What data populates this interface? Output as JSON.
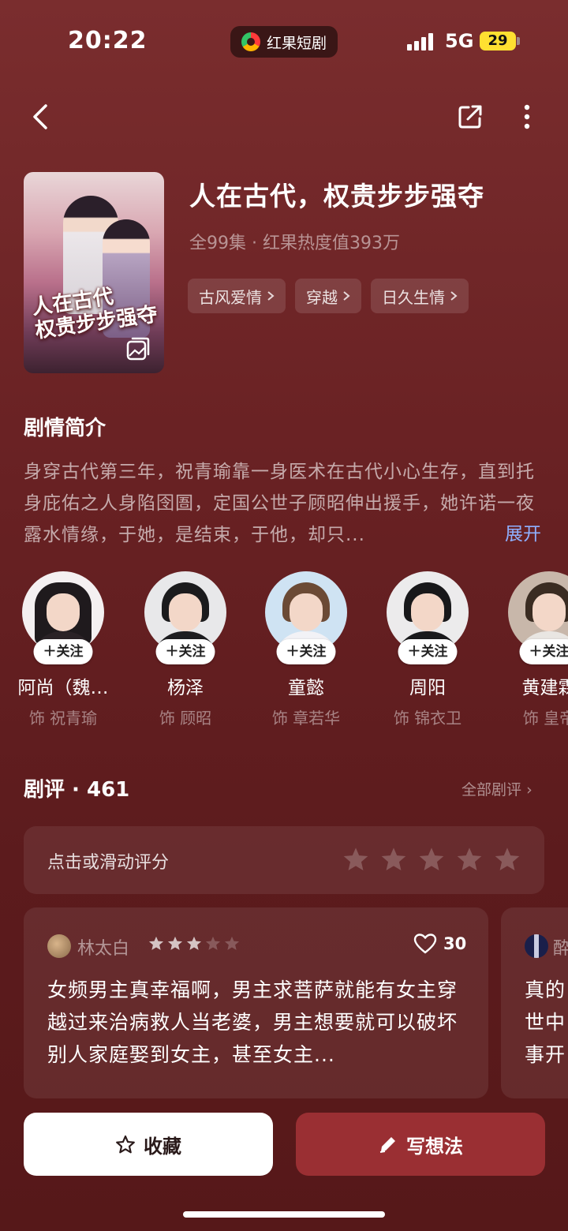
{
  "status_bar": {
    "time": "20:22",
    "app_name": "红果短剧",
    "network": "5G",
    "battery": "29"
  },
  "drama": {
    "title": "人在古代，权贵步步强夺",
    "meta": "全99集 · 红果热度值393万",
    "cover_title_line1": "人在古代",
    "cover_title_line2": "权贵步步强夺",
    "tags": [
      {
        "label": "古风爱情"
      },
      {
        "label": "穿越"
      },
      {
        "label": "日久生情"
      }
    ]
  },
  "synopsis": {
    "heading": "剧情简介",
    "text": "身穿古代第三年，祝青瑜靠一身医术在古代小心生存，直到托身庇佑之人身陷囹圄，定国公世子顾昭伸出援手，她许诺一夜露水情缘，于她，是结束，于他，却只...",
    "expand_label": "展开"
  },
  "cast": {
    "follow_label": "关注",
    "members": [
      {
        "name": "阿尚（魏…",
        "role": "饰 祝青瑜"
      },
      {
        "name": "杨泽",
        "role": "饰 顾昭"
      },
      {
        "name": "童懿",
        "role": "饰 章若华"
      },
      {
        "name": "周阳",
        "role": "饰 锦衣卫"
      },
      {
        "name": "黄建霖",
        "role": "饰 皇帝"
      }
    ]
  },
  "reviews": {
    "heading": "剧评 · 461",
    "all_label": "全部剧评",
    "rate_prompt": "点击或滑动评分",
    "items": [
      {
        "user": "林太白",
        "rating": 3,
        "likes": "30",
        "text": "女频男主真幸福啊，男主求菩萨就能有女主穿越过来治病救人当老婆，男主想要就可以破坏别人家庭娶到女主，甚至女主..."
      },
      {
        "user": "酔",
        "text": "真的世中事开"
      }
    ]
  },
  "actions": {
    "favorite_label": "收藏",
    "write_label": "写想法"
  },
  "colors": {
    "background": "#6a2224",
    "accent_button": "#9a2f33",
    "expand_link": "#8fb0ff",
    "battery": "#ffe031"
  }
}
